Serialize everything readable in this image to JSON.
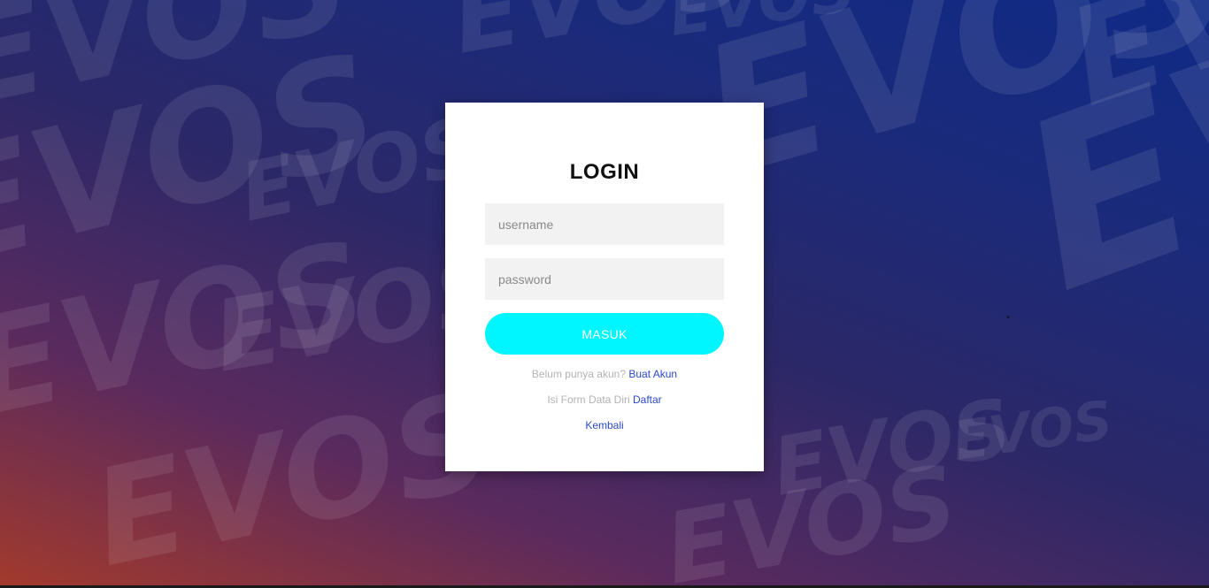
{
  "background": {
    "brand_word": "EVOS",
    "colors": {
      "start": "#a33a2c",
      "mid": "#2b2868",
      "end": "#0f2a86"
    }
  },
  "login": {
    "title": "LOGIN",
    "username_placeholder": "username",
    "password_placeholder": "password",
    "submit_label": "MASUK",
    "no_account_text": "Belum punya akun?",
    "create_account_link": "Buat Akun",
    "form_text": "Isi Form Data Diri",
    "register_link": "Daftar",
    "back_link": "Kembali"
  },
  "colors": {
    "button": "#00f6ff",
    "link": "#2b4ac9",
    "muted_text": "#b3b3b3",
    "field_bg": "#f2f2f2"
  }
}
